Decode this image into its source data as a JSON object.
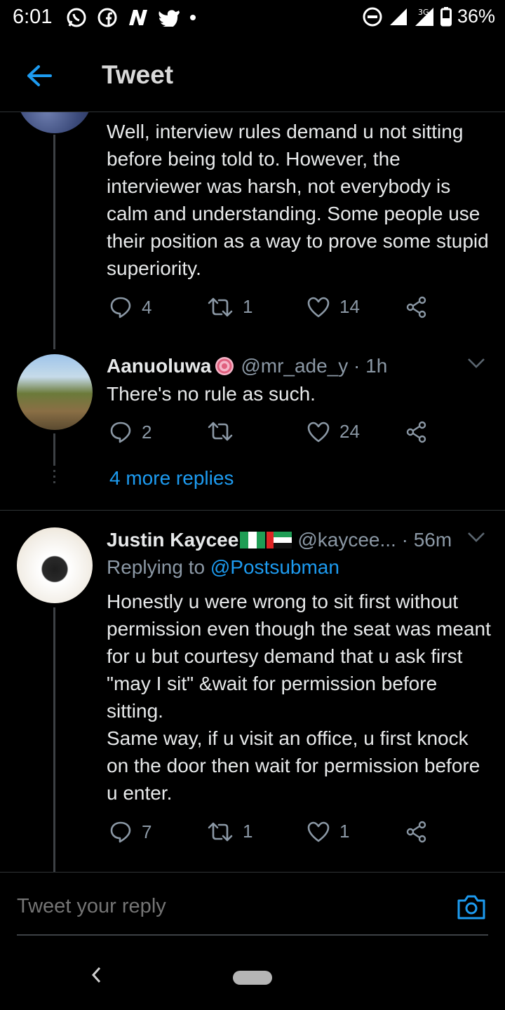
{
  "status_bar": {
    "time": "6:01",
    "network": "3G",
    "battery": "36%",
    "left_icons": [
      "whatsapp-icon",
      "facebook-icon",
      "news-icon",
      "twitter-icon",
      "dot-icon"
    ]
  },
  "app_bar": {
    "title": "Tweet"
  },
  "tweets": [
    {
      "text": "Well, interview rules demand u not sitting before being told to. However, the interviewer was harsh, not everybody is calm and understanding. Some people use their position as a way to prove some stupid superiority.",
      "replies": "4",
      "retweets": "1",
      "likes": "14"
    },
    {
      "name": "Aanuoluwa",
      "handle": "@mr_ade_y · 1h",
      "text": "There's no rule as such.",
      "replies": "2",
      "retweets": "",
      "likes": "24"
    },
    {
      "name": "Justin Kaycee",
      "handle": "@kaycee... · 56m",
      "replying_prefix": "Replying to ",
      "replying_to": "@Postsubman",
      "text_lines": [
        "Honestly u were wrong to sit first without permission even though the seat was meant for u but courtesy demand that u ask first \"may I sit\" &wait for permission before sitting.",
        "Same way, if u visit an office, u first knock on the door then wait for permission before u enter."
      ],
      "replies": "7",
      "retweets": "1",
      "likes": "1"
    }
  ],
  "more_replies": "4 more replies",
  "compose": {
    "placeholder": "Tweet your reply"
  },
  "colors": {
    "accent": "#1d9bf0",
    "muted": "#8b98a5",
    "background": "#000000"
  }
}
